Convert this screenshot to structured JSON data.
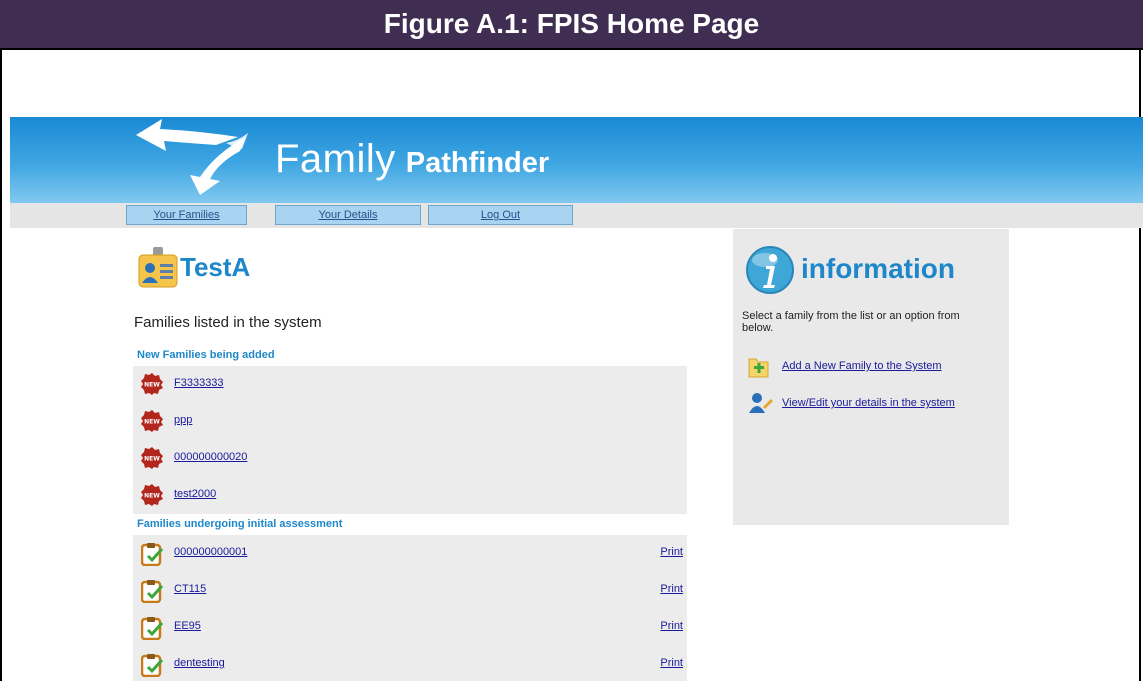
{
  "figure": {
    "caption": "Figure A.1: FPIS Home Page"
  },
  "header": {
    "brand_light": "Family",
    "brand_bold": "Pathfinder"
  },
  "nav": [
    {
      "label": "Your Families"
    },
    {
      "label": "Your Details"
    },
    {
      "label": "Log Out"
    }
  ],
  "main": {
    "title": "TestA",
    "subtitle": "Families listed in the system",
    "sections": [
      {
        "heading": "New Families being added",
        "icon": "new-badge-icon",
        "rows": [
          {
            "name": "F3333333"
          },
          {
            "name": "ppp"
          },
          {
            "name": "000000000020"
          },
          {
            "name": "test2000"
          }
        ]
      },
      {
        "heading": "Families undergoing initial assessment",
        "icon": "clipboard-check-icon",
        "print_label": "Print",
        "rows": [
          {
            "name": "000000000001"
          },
          {
            "name": "CT115"
          },
          {
            "name": "EE95"
          },
          {
            "name": "dentesting"
          }
        ]
      }
    ]
  },
  "info": {
    "title": "information",
    "text": "Select a family from the list or an option from below.",
    "links": [
      {
        "label": "Add a New Family to the System",
        "icon": "add-folder-icon"
      },
      {
        "label": "View/Edit your details in the system",
        "icon": "edit-user-icon"
      }
    ]
  },
  "colors": {
    "accent": "#1e87c9",
    "figure_bar": "#3f2e52",
    "banner": "#1a8ad4",
    "nav_button": "#a8d4f1",
    "new_badge": "#b3261e"
  }
}
